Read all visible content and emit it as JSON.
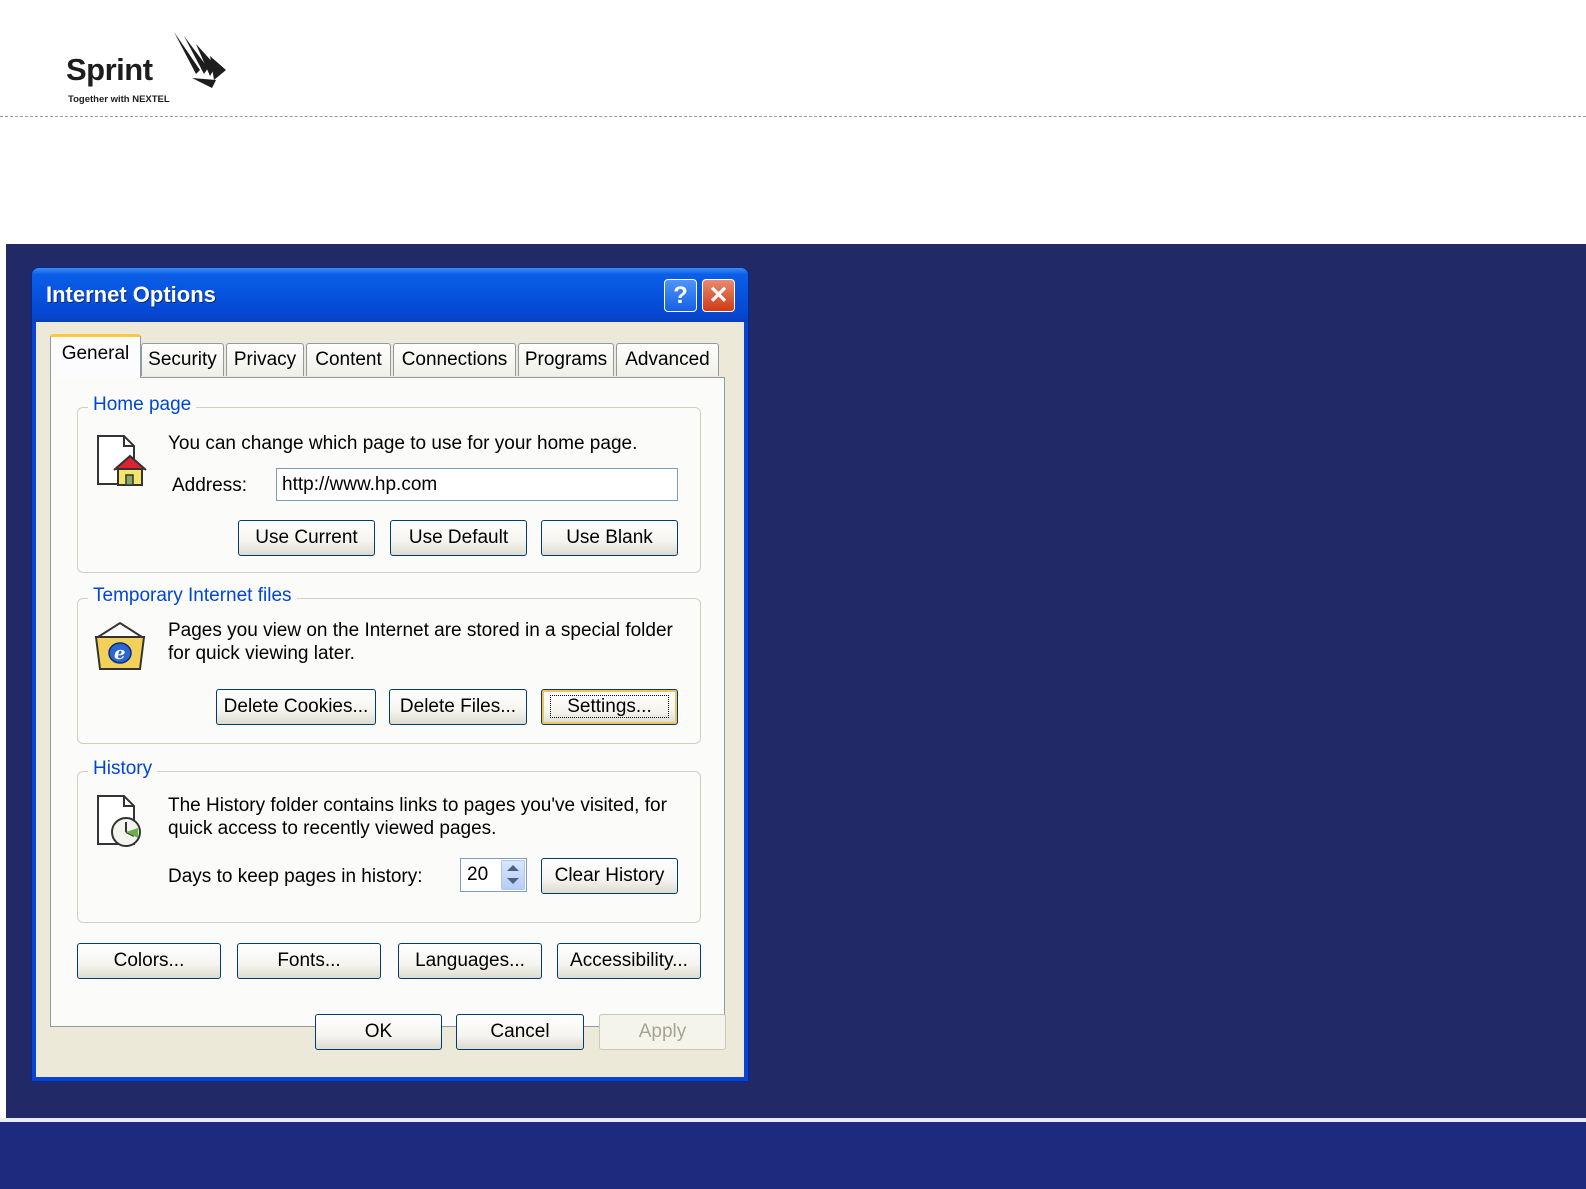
{
  "slide": {
    "logo_word": "Sprint",
    "logo_tagline": "Together with NEXTEL"
  },
  "dialog": {
    "title": "Internet Options",
    "help_glyph": "?",
    "close_glyph": "✕",
    "tabs": [
      "General",
      "Security",
      "Privacy",
      "Content",
      "Connections",
      "Programs",
      "Advanced"
    ],
    "active_tab": "General",
    "home_page": {
      "label": "Home page",
      "description": "You can change which page to use for your home page.",
      "address_label": "Address:",
      "address_value": "http://www.hp.com",
      "use_current": "Use Current",
      "use_default": "Use Default",
      "use_blank": "Use Blank"
    },
    "temp_files": {
      "label": "Temporary Internet files",
      "description_line1": "Pages you view on the Internet are stored in a special folder",
      "description_line2": "for quick viewing later.",
      "delete_cookies": "Delete Cookies...",
      "delete_files": "Delete Files...",
      "settings": "Settings..."
    },
    "history": {
      "label": "History",
      "description_line1": "The History folder contains links to pages you've visited, for",
      "description_line2": "quick access to recently viewed pages.",
      "days_label": "Days to keep pages in history:",
      "days_value": "20",
      "clear_history": "Clear History"
    },
    "bottom_buttons": {
      "colors": "Colors...",
      "fonts": "Fonts...",
      "languages": "Languages...",
      "accessibility": "Accessibility..."
    },
    "footer": {
      "ok": "OK",
      "cancel": "Cancel",
      "apply": "Apply"
    }
  },
  "colors": {
    "navy_panel": "#212966",
    "bottom_band": "#1d2b7f",
    "xp_title_blue": "#0653df",
    "group_label_blue": "#0046d5"
  }
}
